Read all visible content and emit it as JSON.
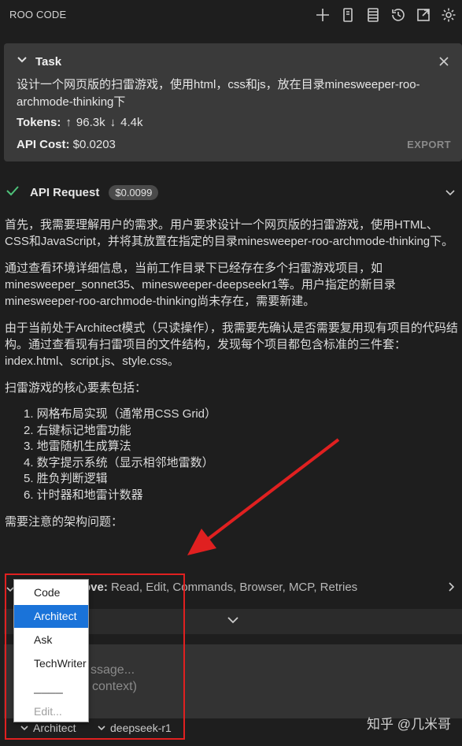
{
  "app": {
    "title": "ROO CODE"
  },
  "toolbar": {
    "icons": [
      "plus-icon",
      "prompts-icon",
      "mcp-servers-icon",
      "history-icon",
      "popout-icon",
      "settings-icon"
    ]
  },
  "task": {
    "label": "Task",
    "text": "设计一个网页版的扫雷游戏，使用html，css和js，放在目录minesweeper-roo-archmode-thinking下",
    "tokens_label": "Tokens:",
    "tokens_up": "96.3k",
    "tokens_down": "4.4k",
    "api_cost_label": "API Cost:",
    "api_cost_value": "$0.0203",
    "export_label": "EXPORT"
  },
  "api_request": {
    "title": "API Request",
    "cost": "$0.0099"
  },
  "message": {
    "p1": "首先，我需要理解用户的需求。用户要求设计一个网页版的扫雷游戏，使用HTML、CSS和JavaScript，并将其放置在指定的目录minesweeper-roo-archmode-thinking下。",
    "p2": "通过查看环境详细信息，当前工作目录下已经存在多个扫雷游戏项目，如minesweeper_sonnet35、minesweeper-deepseekr1等。用户指定的新目录minesweeper-roo-archmode-thinking尚未存在，需要新建。",
    "p3": "由于当前处于Architect模式（只读操作），我需要先确认是否需要复用现有项目的代码结构。通过查看现有扫雷项目的文件结构，发现每个项目都包含标准的三件套：index.html、script.js、style.css。",
    "p4": "扫雷游戏的核心要素包括：",
    "list": [
      "1. 网格布局实现（通常用CSS Grid）",
      "2. 右键标记地雷功能",
      "3. 地雷随机生成算法",
      "4. 数字提示系统（显示相邻地雷数）",
      "5. 胜负判断逻辑",
      "6. 计时器和地雷计数器"
    ],
    "p5": "需要注意的架构问题："
  },
  "auto_approve": {
    "label": "ove:",
    "items": "Read, Edit, Commands, Browser, MCP, Retries"
  },
  "input": {
    "placeholder_line1": "ssage...",
    "placeholder_line2": "context)"
  },
  "footer": {
    "mode": "Architect",
    "model": "deepseek-r1",
    "watermark": "知乎 @几米哥"
  },
  "mode_dropdown": {
    "options": [
      "Code",
      "Architect",
      "Ask",
      "TechWriter"
    ],
    "selected": "Architect",
    "separator": "────",
    "edit": "Edit..."
  },
  "colors": {
    "background": "#1e1e1e",
    "card": "#3a3a3a",
    "check": "#4ec27a",
    "selected": "#1a73d9",
    "annotation": "#e02020"
  }
}
